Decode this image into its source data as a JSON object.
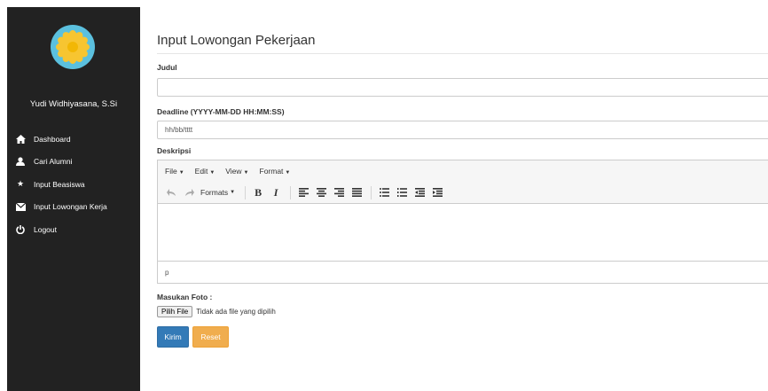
{
  "sidebar": {
    "username": "Yudi Widhiyasana, S.Si",
    "items": [
      {
        "label": "Dashboard",
        "icon": "home-icon"
      },
      {
        "label": "Cari Alumni",
        "icon": "user-icon"
      },
      {
        "label": "Input Beasiswa",
        "icon": "star-icon"
      },
      {
        "label": "Input Lowongan Kerja",
        "icon": "envelope-icon"
      },
      {
        "label": "Logout",
        "icon": "power-icon"
      }
    ]
  },
  "form": {
    "title": "Input Lowongan Pekerjaan",
    "judul_label": "Judul",
    "judul_value": "",
    "deadline_label": "Deadline (YYYY-MM-DD HH:MM:SS)",
    "deadline_placeholder": "hh/bb/tttt",
    "deskripsi_label": "Deskripsi",
    "editor": {
      "menus": [
        "File",
        "Edit",
        "View",
        "Format"
      ],
      "formats_label": "Formats",
      "bold_label": "B",
      "italic_label": "I",
      "status_path": "p"
    },
    "foto_label": "Masukan Foto :",
    "file_button": "Pilih File",
    "file_status": "Tidak ada file yang dipilih",
    "submit_label": "Kirim",
    "reset_label": "Reset"
  },
  "colors": {
    "sidebar_bg": "#222222",
    "avatar_bg": "#5bc0de",
    "avatar_flower": "#f7c531",
    "primary": "#337ab7",
    "warning": "#f0ad4e"
  }
}
